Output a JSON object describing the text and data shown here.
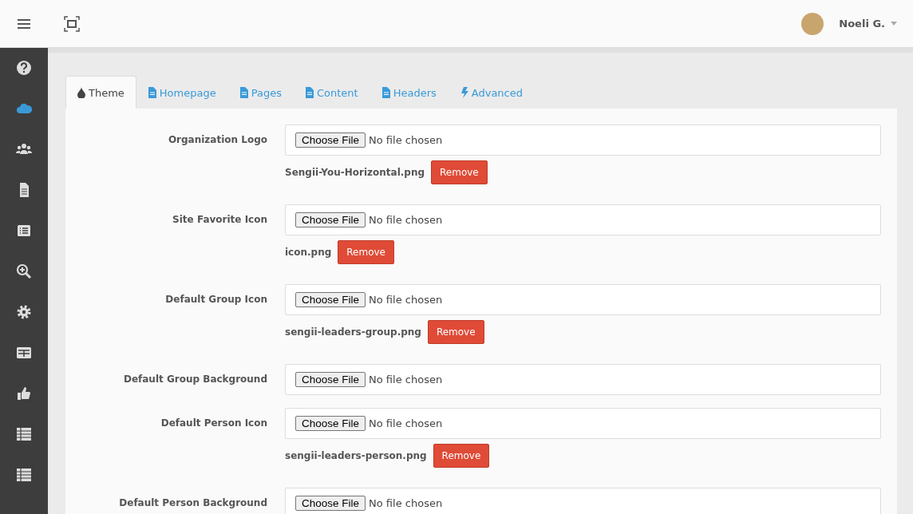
{
  "topbar": {
    "user_name": "Noeli G."
  },
  "sidebar": {
    "items": [
      {
        "kind": "help",
        "selected": false
      },
      {
        "kind": "cloud",
        "selected": true
      },
      {
        "kind": "people",
        "selected": false
      },
      {
        "kind": "document",
        "selected": false
      },
      {
        "kind": "list",
        "selected": false
      },
      {
        "kind": "zoom",
        "selected": false
      },
      {
        "kind": "settings",
        "selected": false
      },
      {
        "kind": "grid",
        "selected": false
      },
      {
        "kind": "thumb",
        "selected": false
      },
      {
        "kind": "table",
        "selected": false
      },
      {
        "kind": "table",
        "selected": false
      }
    ]
  },
  "tabs": [
    {
      "label": "Theme",
      "kind": "drop",
      "selected": true
    },
    {
      "label": "Homepage",
      "kind": "file",
      "selected": false
    },
    {
      "label": "Pages",
      "kind": "file",
      "selected": false
    },
    {
      "label": "Content",
      "kind": "file",
      "selected": false
    },
    {
      "label": "Headers",
      "kind": "file",
      "selected": false
    },
    {
      "label": "Advanced",
      "kind": "bolt",
      "selected": false
    }
  ],
  "fields": [
    {
      "label": "Organization Logo",
      "button": "Choose File",
      "status": "No file chosen",
      "file_name": "Sengii-You-Horizontal.png",
      "remove": "Remove"
    },
    {
      "label": "Site Favorite Icon",
      "button": "Choose File",
      "status": "No file chosen",
      "file_name": "icon.png",
      "remove": "Remove"
    },
    {
      "label": "Default Group Icon",
      "button": "Choose File",
      "status": "No file chosen",
      "file_name": "sengii-leaders-group.png",
      "remove": "Remove"
    },
    {
      "label": "Default Group Background",
      "button": "Choose File",
      "status": "No file chosen"
    },
    {
      "label": "Default Person Icon",
      "button": "Choose File",
      "status": "No file chosen",
      "file_name": "sengii-leaders-person.png",
      "remove": "Remove"
    },
    {
      "label": "Default Person Background",
      "button": "Choose File",
      "status": "No file chosen"
    }
  ]
}
